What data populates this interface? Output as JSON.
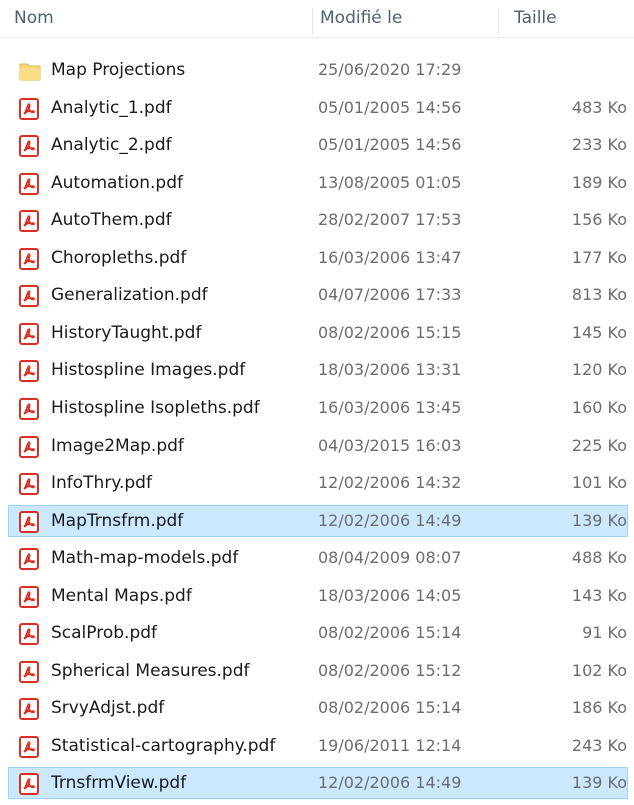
{
  "columns": {
    "name": "Nom",
    "date": "Modifié le",
    "size": "Taille"
  },
  "colors": {
    "selection_bg": "#cce8ff",
    "selection_border": "#99d1ff",
    "pdf_red": "#d93025",
    "folder_yellow": "#f8d775"
  },
  "files": [
    {
      "name": "Map Projections",
      "date": "25/06/2020 17:29",
      "size": "",
      "icon": "folder-icon",
      "selected": false
    },
    {
      "name": "Analytic_1.pdf",
      "date": "05/01/2005 14:56",
      "size": "483 Ko",
      "icon": "pdf-icon",
      "selected": false
    },
    {
      "name": "Analytic_2.pdf",
      "date": "05/01/2005 14:56",
      "size": "233 Ko",
      "icon": "pdf-icon",
      "selected": false
    },
    {
      "name": "Automation.pdf",
      "date": "13/08/2005 01:05",
      "size": "189 Ko",
      "icon": "pdf-icon",
      "selected": false
    },
    {
      "name": "AutoThem.pdf",
      "date": "28/02/2007 17:53",
      "size": "156 Ko",
      "icon": "pdf-icon",
      "selected": false
    },
    {
      "name": "Choropleths.pdf",
      "date": "16/03/2006 13:47",
      "size": "177 Ko",
      "icon": "pdf-icon",
      "selected": false
    },
    {
      "name": "Generalization.pdf",
      "date": "04/07/2006 17:33",
      "size": "813 Ko",
      "icon": "pdf-icon",
      "selected": false
    },
    {
      "name": "HistoryTaught.pdf",
      "date": "08/02/2006 15:15",
      "size": "145 Ko",
      "icon": "pdf-icon",
      "selected": false
    },
    {
      "name": "Histospline Images.pdf",
      "date": "18/03/2006 13:31",
      "size": "120 Ko",
      "icon": "pdf-icon",
      "selected": false
    },
    {
      "name": "Histospline Isopleths.pdf",
      "date": "16/03/2006 13:45",
      "size": "160 Ko",
      "icon": "pdf-icon",
      "selected": false
    },
    {
      "name": "Image2Map.pdf",
      "date": "04/03/2015 16:03",
      "size": "225 Ko",
      "icon": "pdf-icon",
      "selected": false
    },
    {
      "name": "InfoThry.pdf",
      "date": "12/02/2006 14:32",
      "size": "101 Ko",
      "icon": "pdf-icon",
      "selected": false
    },
    {
      "name": "MapTrnsfrm.pdf",
      "date": "12/02/2006 14:49",
      "size": "139 Ko",
      "icon": "pdf-icon",
      "selected": true
    },
    {
      "name": "Math-map-models.pdf",
      "date": "08/04/2009 08:07",
      "size": "488 Ko",
      "icon": "pdf-icon",
      "selected": false
    },
    {
      "name": "Mental Maps.pdf",
      "date": "18/03/2006 14:05",
      "size": "143 Ko",
      "icon": "pdf-icon",
      "selected": false
    },
    {
      "name": "ScalProb.pdf",
      "date": "08/02/2006 15:14",
      "size": "91 Ko",
      "icon": "pdf-icon",
      "selected": false
    },
    {
      "name": "Spherical Measures.pdf",
      "date": "08/02/2006 15:12",
      "size": "102 Ko",
      "icon": "pdf-icon",
      "selected": false
    },
    {
      "name": "SrvyAdjst.pdf",
      "date": "08/02/2006 15:14",
      "size": "186 Ko",
      "icon": "pdf-icon",
      "selected": false
    },
    {
      "name": "Statistical-cartography.pdf",
      "date": "19/06/2011 12:14",
      "size": "243 Ko",
      "icon": "pdf-icon",
      "selected": false
    },
    {
      "name": "TrnsfrmView.pdf",
      "date": "12/02/2006 14:49",
      "size": "139 Ko",
      "icon": "pdf-icon",
      "selected": true
    }
  ]
}
